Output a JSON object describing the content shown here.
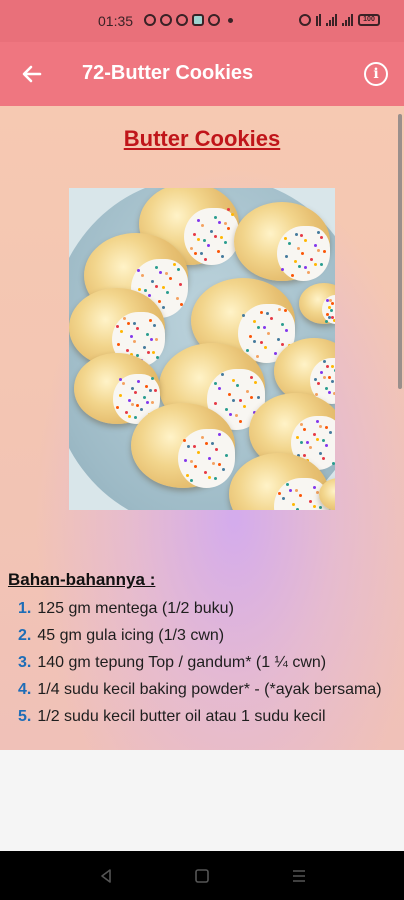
{
  "status_bar": {
    "time": "01:35",
    "battery": "100"
  },
  "app_bar": {
    "title": "72-Butter Cookies",
    "back_icon": "arrow-left-icon",
    "info_icon": "info-icon",
    "info_glyph": "i"
  },
  "recipe": {
    "title": "Butter Cookies",
    "image_alt": "cookie-photo",
    "ingredients_heading": "Bahan-bahannya :",
    "ingredients": [
      {
        "num": "1.",
        "text": "125 gm mentega (1/2 buku)"
      },
      {
        "num": "2.",
        "text": "45 gm gula icing (1/3 cwn)"
      },
      {
        "num": "3.",
        "text": "140 gm tepung Top / gandum* (1 ¼ cwn)"
      },
      {
        "num": "4.",
        "text": "1/4 sudu kecil baking powder* - (*ayak bersama)"
      },
      {
        "num": "5.",
        "text": "1/2 sudu kecil butter oil atau 1 sudu kecil"
      }
    ]
  },
  "colors": {
    "app_bar": "#ef7680",
    "status_bar": "#e9707a",
    "title_red": "#c0151a",
    "number_blue": "#1e6db7"
  }
}
